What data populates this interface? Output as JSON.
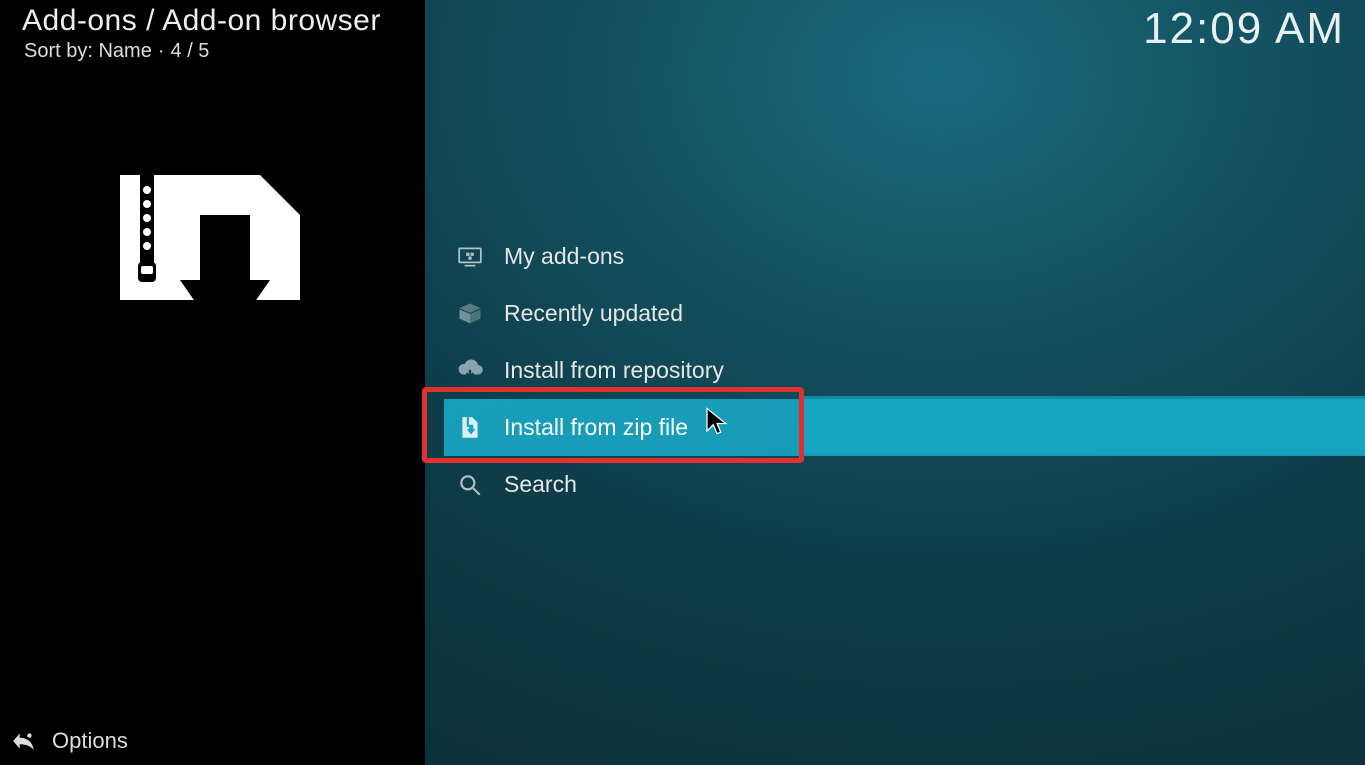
{
  "header": {
    "breadcrumb": "Add-ons / Add-on browser",
    "sort_prefix": "Sort by: ",
    "sort_value": "Name",
    "position": "4 / 5",
    "clock": "12:09 AM"
  },
  "menu": {
    "items": [
      {
        "label": "My add-ons",
        "icon": "monitor-addons-icon",
        "selected": false
      },
      {
        "label": "Recently updated",
        "icon": "open-box-icon",
        "selected": false
      },
      {
        "label": "Install from repository",
        "icon": "cloud-download-icon",
        "selected": false
      },
      {
        "label": "Install from zip file",
        "icon": "zip-file-icon",
        "selected": true
      },
      {
        "label": "Search",
        "icon": "search-icon",
        "selected": false
      }
    ]
  },
  "footer": {
    "options_label": "Options"
  }
}
